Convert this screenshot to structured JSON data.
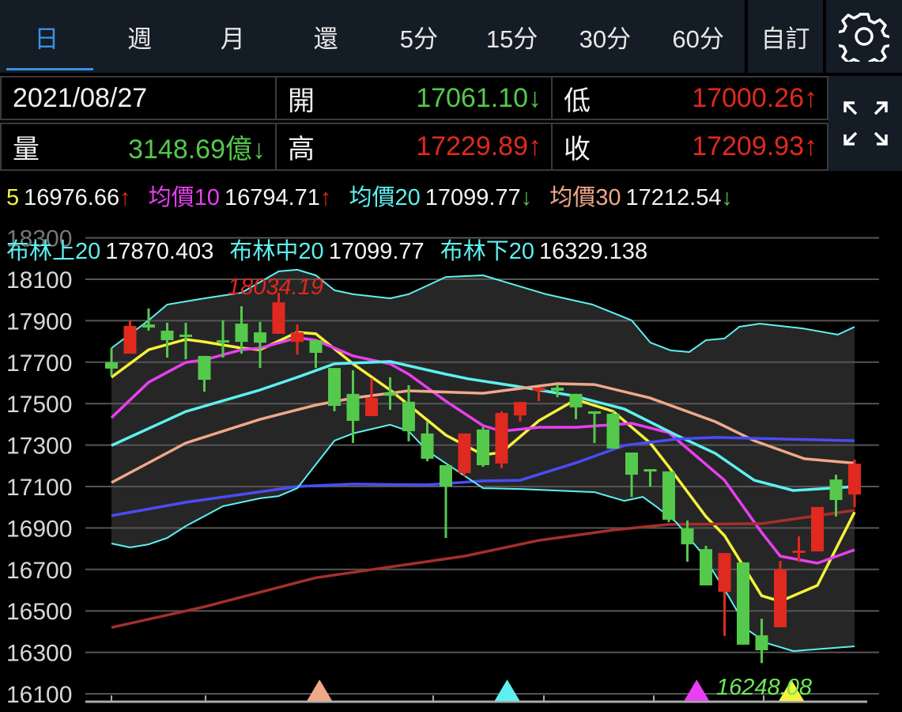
{
  "tabs": [
    {
      "label": "日",
      "active": true
    },
    {
      "label": "週"
    },
    {
      "label": "月"
    },
    {
      "label": "還"
    },
    {
      "label": "5分"
    },
    {
      "label": "15分"
    },
    {
      "label": "30分"
    },
    {
      "label": "60分"
    }
  ],
  "custom_label": "自訂",
  "info": {
    "date": "2021/08/27",
    "open_label": "開",
    "open_value": "17061.10↓",
    "low_label": "低",
    "low_value": "17000.26↑",
    "volume_label": "量",
    "volume_value": "3148.69億↓",
    "high_label": "高",
    "high_value": "17229.89↑",
    "close_label": "收",
    "close_value": "17209.93↑"
  },
  "ma_row": [
    {
      "label": "5",
      "value": "16976.66",
      "arrow": "↑",
      "color": "#f5f23a"
    },
    {
      "label": "均價10",
      "value": "16794.71",
      "arrow": "↑",
      "color": "#e83ff0"
    },
    {
      "label": "均價20",
      "value": "17099.77",
      "arrow": "↓",
      "color": "#5ef0f0"
    },
    {
      "label": "均價30",
      "value": "17212.54",
      "arrow": "↓",
      "color": "#f0a88a"
    }
  ],
  "bb_row": [
    {
      "label": "布林上20",
      "value": "17870.403"
    },
    {
      "label": "布林中20",
      "value": "17099.77"
    },
    {
      "label": "布林下20",
      "value": "16329.138"
    }
  ],
  "colors": {
    "up": "#e0291f",
    "down": "#54c94b",
    "accent": "#3d8fe8"
  },
  "chart_data": {
    "type": "candlestick",
    "y_ticks": [
      16100,
      16300,
      16500,
      16700,
      16900,
      17100,
      17300,
      17500,
      17700,
      17900,
      18100,
      18300
    ],
    "ylim": [
      16100,
      18300
    ],
    "candles": [
      [
        17699,
        17768,
        17634,
        17669
      ],
      [
        17741,
        17902,
        17741,
        17875
      ],
      [
        17882,
        17959,
        17852,
        17867
      ],
      [
        17852,
        17890,
        17722,
        17806
      ],
      [
        17833,
        17890,
        17714,
        17825
      ],
      [
        17730,
        17730,
        17558,
        17615
      ],
      [
        17806,
        17902,
        17722,
        17798
      ],
      [
        17886,
        17970,
        17741,
        17798
      ],
      [
        17844,
        17894,
        17672,
        17794
      ],
      [
        17837,
        18034.19,
        17837,
        17989
      ],
      [
        17798,
        17882,
        17737,
        17844
      ],
      [
        17806,
        17806,
        17672,
        17745
      ],
      [
        17672,
        17672,
        17463,
        17489
      ],
      [
        17547,
        17661,
        17310,
        17417
      ],
      [
        17440,
        17623,
        17440,
        17528
      ],
      [
        17553,
        17627,
        17470,
        17538
      ],
      [
        17509,
        17589,
        17318,
        17367
      ],
      [
        17356,
        17413,
        17222,
        17234
      ],
      [
        17203,
        17203,
        16852,
        17100
      ],
      [
        17165,
        17356,
        17150,
        17356
      ],
      [
        17375,
        17386,
        17195,
        17203
      ],
      [
        17211,
        17463,
        17188,
        17455
      ],
      [
        17443,
        17508,
        17413,
        17508
      ],
      [
        17562,
        17577,
        17512,
        17577
      ],
      [
        17577,
        17592,
        17531,
        17562
      ],
      [
        17547,
        17547,
        17425,
        17482
      ],
      [
        17463,
        17463,
        17310,
        17451
      ],
      [
        17451,
        17463,
        17283,
        17283
      ],
      [
        17264,
        17264,
        17050,
        17157
      ],
      [
        17184,
        17184,
        17100,
        17176
      ],
      [
        17173,
        17173,
        16928,
        16940
      ],
      [
        16898,
        16936,
        16737,
        16821
      ],
      [
        16798,
        16814,
        16623,
        16623
      ],
      [
        16592,
        16779,
        16379,
        16779
      ],
      [
        16734,
        16734,
        16337,
        16337
      ],
      [
        16382,
        16462,
        16248.08,
        16310
      ],
      [
        16421,
        16741,
        16421,
        16699
      ],
      [
        16787,
        16860,
        16737,
        16791
      ],
      [
        16787,
        17001,
        16787,
        17001
      ],
      [
        17134,
        17157,
        16955,
        17035
      ],
      [
        17061.1,
        17229.89,
        17000.26,
        17209.93
      ]
    ],
    "overlays": [
      {
        "name": "ma5",
        "color": "#f5f23a",
        "points": [
          [
            0,
            17627
          ],
          [
            2,
            17760
          ],
          [
            4,
            17810
          ],
          [
            5,
            17798
          ],
          [
            7,
            17768
          ],
          [
            8,
            17760
          ],
          [
            10,
            17844
          ],
          [
            11,
            17837
          ],
          [
            13,
            17692
          ],
          [
            15,
            17566
          ],
          [
            18,
            17348
          ],
          [
            20,
            17253
          ],
          [
            21,
            17264
          ],
          [
            23,
            17417
          ],
          [
            25,
            17520
          ],
          [
            27,
            17463
          ],
          [
            29,
            17310
          ],
          [
            30,
            17195
          ],
          [
            32,
            16955
          ],
          [
            33,
            16863
          ],
          [
            35,
            16573
          ],
          [
            36,
            16546
          ],
          [
            38,
            16623
          ],
          [
            40,
            16976.66
          ]
        ]
      },
      {
        "name": "ma10",
        "color": "#e83ff0",
        "points": [
          [
            0,
            17432
          ],
          [
            2,
            17603
          ],
          [
            4,
            17699
          ],
          [
            5,
            17711
          ],
          [
            7,
            17760
          ],
          [
            8,
            17768
          ],
          [
            10,
            17818
          ],
          [
            11,
            17806
          ],
          [
            13,
            17730
          ],
          [
            15,
            17692
          ],
          [
            16,
            17642
          ],
          [
            18,
            17512
          ],
          [
            20,
            17394
          ],
          [
            21,
            17367
          ],
          [
            23,
            17386
          ],
          [
            25,
            17386
          ],
          [
            28,
            17405
          ],
          [
            30,
            17360
          ],
          [
            33,
            17130
          ],
          [
            35,
            16878
          ],
          [
            36,
            16764
          ],
          [
            38,
            16730
          ],
          [
            40,
            16794.71
          ]
        ]
      },
      {
        "name": "ma20",
        "color": "#5ef0f0",
        "points": [
          [
            0,
            17298
          ],
          [
            4,
            17462
          ],
          [
            8,
            17566
          ],
          [
            10,
            17627
          ],
          [
            12,
            17692
          ],
          [
            15,
            17703
          ],
          [
            18,
            17642
          ],
          [
            19.2,
            17620
          ],
          [
            21.7,
            17585
          ],
          [
            24.8,
            17539
          ],
          [
            27.6,
            17474
          ],
          [
            30.4,
            17348
          ],
          [
            32.5,
            17260
          ],
          [
            34.6,
            17130
          ],
          [
            36.7,
            17081
          ],
          [
            40,
            17099.77
          ]
        ]
      },
      {
        "name": "ma30",
        "color": "#f0a88a",
        "points": [
          [
            0,
            17119
          ],
          [
            4,
            17310
          ],
          [
            8,
            17424
          ],
          [
            11,
            17493
          ],
          [
            13,
            17527
          ],
          [
            16,
            17562
          ],
          [
            20,
            17550
          ],
          [
            24,
            17596
          ],
          [
            26,
            17592
          ],
          [
            29,
            17527
          ],
          [
            32.5,
            17413
          ],
          [
            34.6,
            17321
          ],
          [
            37.3,
            17234
          ],
          [
            40,
            17212.54
          ]
        ]
      },
      {
        "name": "ma60",
        "color": "#4a4cf5",
        "points": [
          [
            0,
            16959
          ],
          [
            4,
            17024
          ],
          [
            10,
            17100
          ],
          [
            13,
            17112
          ],
          [
            17,
            17108
          ],
          [
            20,
            17127
          ],
          [
            22,
            17130
          ],
          [
            25,
            17214
          ],
          [
            27.6,
            17298
          ],
          [
            30.4,
            17329
          ],
          [
            32.5,
            17337
          ],
          [
            40,
            17321
          ]
        ]
      },
      {
        "name": "ma120",
        "color": "#a3302b",
        "points": [
          [
            0,
            16420
          ],
          [
            5,
            16520
          ],
          [
            11,
            16660
          ],
          [
            19,
            16764
          ],
          [
            23,
            16840
          ],
          [
            27,
            16890
          ],
          [
            30,
            16917
          ],
          [
            35,
            16921
          ],
          [
            40,
            16985
          ]
        ]
      },
      {
        "name": "bb-upper",
        "color": "#5ef0f0",
        "thin": true,
        "points": [
          [
            0,
            17768
          ],
          [
            2,
            17902
          ],
          [
            3,
            17978
          ],
          [
            5,
            18008
          ],
          [
            7,
            18035
          ],
          [
            9,
            18138
          ],
          [
            10,
            18146
          ],
          [
            11,
            18119
          ],
          [
            12,
            18047
          ],
          [
            13,
            18028
          ],
          [
            15,
            18008
          ],
          [
            16,
            18028
          ],
          [
            18,
            18111
          ],
          [
            20,
            18119
          ],
          [
            21.7,
            18073
          ],
          [
            23.4,
            18028
          ],
          [
            25.9,
            17978
          ],
          [
            28,
            17902
          ],
          [
            29,
            17795
          ],
          [
            30.1,
            17757
          ],
          [
            31.1,
            17749
          ],
          [
            32,
            17806
          ],
          [
            33,
            17814
          ],
          [
            33.8,
            17871
          ],
          [
            34.9,
            17886
          ],
          [
            37.2,
            17863
          ],
          [
            39.1,
            17833
          ],
          [
            40,
            17870.403
          ]
        ]
      },
      {
        "name": "bb-lower",
        "color": "#5ef0f0",
        "thin": true,
        "points": [
          [
            0,
            16825
          ],
          [
            1,
            16806
          ],
          [
            2,
            16821
          ],
          [
            3,
            16852
          ],
          [
            4,
            16909
          ],
          [
            6,
            17005
          ],
          [
            8,
            17043
          ],
          [
            9,
            17054
          ],
          [
            10,
            17092
          ],
          [
            12,
            17321
          ],
          [
            13,
            17356
          ],
          [
            15,
            17398
          ],
          [
            16,
            17367
          ],
          [
            17,
            17272
          ],
          [
            20,
            17092
          ],
          [
            22,
            17088
          ],
          [
            26,
            17073
          ],
          [
            27.6,
            17031
          ],
          [
            28.6,
            17050
          ],
          [
            29.3,
            17005
          ],
          [
            30.4,
            16928
          ],
          [
            31.8,
            16776
          ],
          [
            33.2,
            16573
          ],
          [
            34.3,
            16405
          ],
          [
            35.3,
            16344
          ],
          [
            36.7,
            16306
          ],
          [
            40,
            16329.138
          ]
        ]
      }
    ],
    "high_label": "18034.19",
    "low_label": "16248.08",
    "markers": [
      {
        "index": 11.2,
        "color": "#f0a88a"
      },
      {
        "index": 21.3,
        "color": "#5ef0f0"
      },
      {
        "index": 31.5,
        "color": "#e83ff0"
      },
      {
        "index": 36.6,
        "color": "#f5f23a"
      }
    ]
  }
}
